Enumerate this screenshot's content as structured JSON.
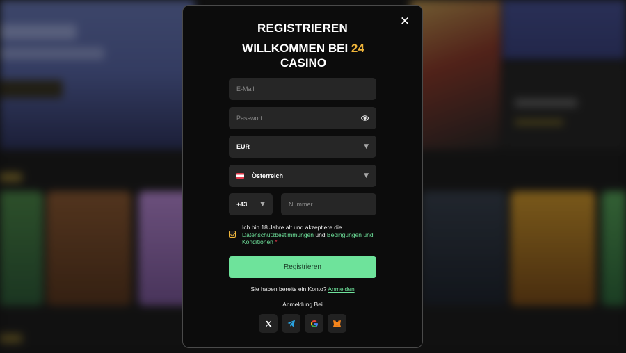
{
  "modal": {
    "title": "REGISTRIEREN",
    "welcome_prefix": "WILLKOMMEN BEI ",
    "welcome_accent": "24",
    "welcome_suffix": "CASINO",
    "close_symbol": "✕"
  },
  "form": {
    "email_placeholder": "E-Mail",
    "password_placeholder": "Passwort",
    "currency": "EUR",
    "country": "Österreich",
    "phone_code": "+43",
    "phone_placeholder": "Nummer",
    "consent_text_1": "Ich bin 18 Jahre alt und akzeptiere die ",
    "consent_link_privacy": "Datenschutzbestimmungen",
    "consent_and": " und ",
    "consent_link_terms": "Bedingungen und Konditionen",
    "consent_required_mark": " *",
    "submit_label": "Registrieren"
  },
  "login": {
    "prompt": "Sie haben bereits ein Konto? ",
    "link": "Anmelden"
  },
  "social": {
    "label": "Anmeldung Bei",
    "providers": [
      "x-icon",
      "telegram-icon",
      "google-icon",
      "metamask-icon"
    ]
  },
  "colors": {
    "accent_gold": "#f0b53a",
    "accent_green": "#6ee39b",
    "modal_bg": "#0c0c0c",
    "field_bg": "#262626"
  }
}
